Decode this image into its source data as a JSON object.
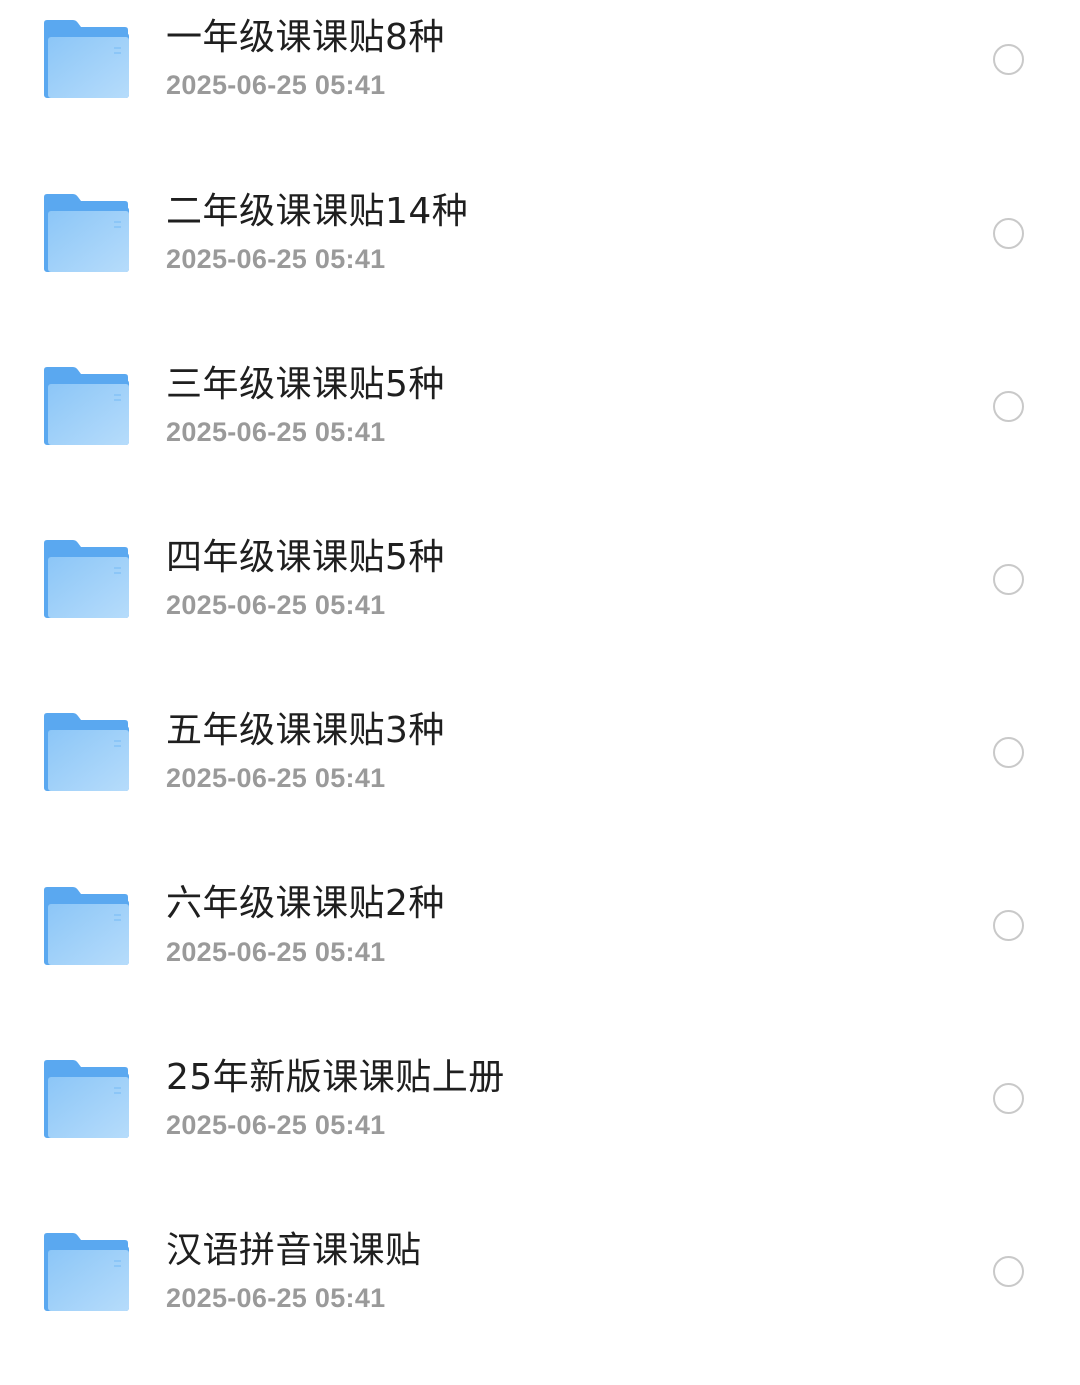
{
  "colors": {
    "folder_top": "#5aa8f0",
    "folder_front_light": "#b6dcfb",
    "folder_front_dark": "#8cc6f7",
    "title_text": "#1f1f1f",
    "date_text": "#9a9a9a",
    "radio_border": "#c9c9c9"
  },
  "icons": {
    "item_icon": "folder-icon",
    "selector": "radio-unchecked-icon"
  },
  "file_list": {
    "items": [
      {
        "name": "一年级课课贴8种",
        "date": "2025-06-25 05:41",
        "selected": false
      },
      {
        "name": "二年级课课贴14种",
        "date": "2025-06-25 05:41",
        "selected": false
      },
      {
        "name": "三年级课课贴5种",
        "date": "2025-06-25 05:41",
        "selected": false
      },
      {
        "name": "四年级课课贴5种",
        "date": "2025-06-25 05:41",
        "selected": false
      },
      {
        "name": "五年级课课贴3种",
        "date": "2025-06-25 05:41",
        "selected": false
      },
      {
        "name": "六年级课课贴2种",
        "date": "2025-06-25 05:41",
        "selected": false
      },
      {
        "name": "25年新版课课贴上册",
        "date": "2025-06-25 05:41",
        "selected": false
      },
      {
        "name": "汉语拼音课课贴",
        "date": "2025-06-25 05:41",
        "selected": false
      }
    ]
  }
}
